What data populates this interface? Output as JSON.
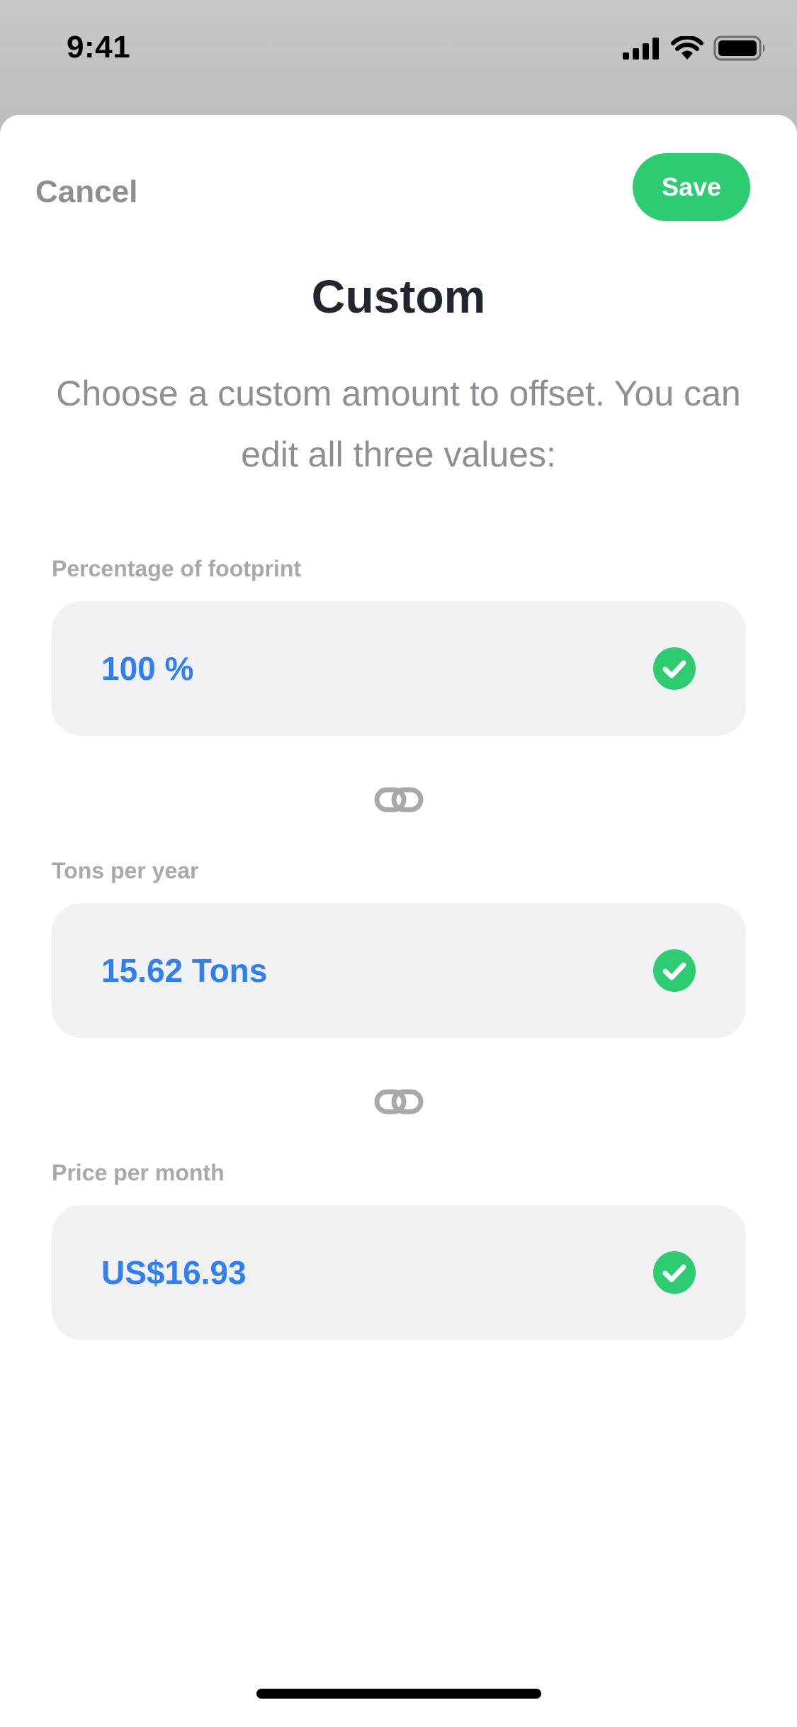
{
  "status_bar": {
    "time": "9:41"
  },
  "header": {
    "cancel_label": "Cancel",
    "save_label": "Save",
    "title": "Custom",
    "subtitle": "Choose a custom amount to offset. You can edit all three values:"
  },
  "fields": [
    {
      "label": "Percentage of footprint",
      "value": "100 %",
      "valid": true
    },
    {
      "label": "Tons per year",
      "value": "15.62 Tons",
      "valid": true
    },
    {
      "label": "Price per month",
      "value": "US$16.93",
      "valid": true
    }
  ],
  "icons": {
    "check": "check-circle-icon",
    "link": "link-icon",
    "signal": "cellular-signal-icon",
    "wifi": "wifi-icon",
    "battery": "battery-icon"
  },
  "colors": {
    "accent_green": "#2ecc71",
    "value_blue": "#2d7ff2",
    "label_gray": "#a8a9ad",
    "field_background": "#f1f1f3",
    "title_dark": "#22262e"
  }
}
